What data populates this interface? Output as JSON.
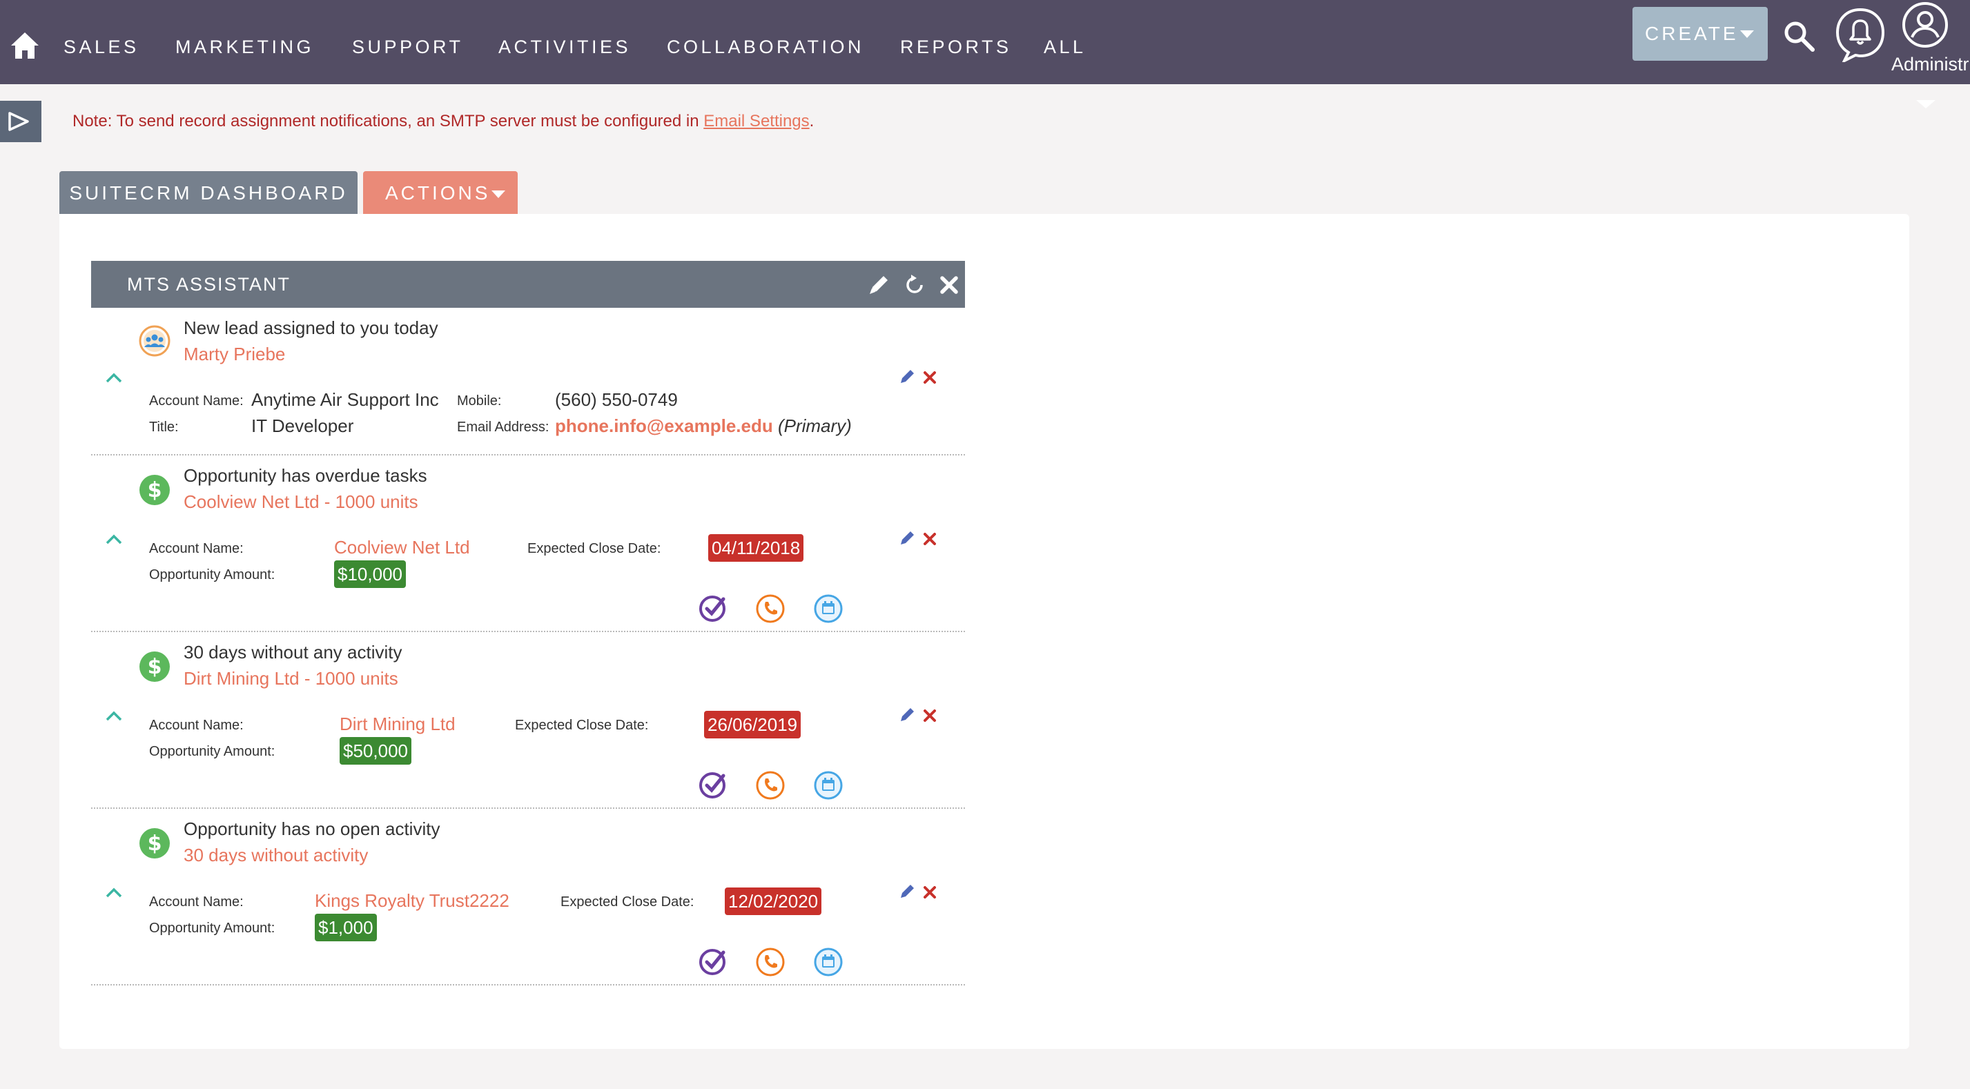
{
  "nav": {
    "items": [
      "SALES",
      "MARKETING",
      "SUPPORT",
      "ACTIVITIES",
      "COLLABORATION",
      "REPORTS",
      "ALL"
    ],
    "create_label": "CREATE",
    "user_label": "Administr"
  },
  "note": {
    "text": "Note: To send record assignment notifications, an SMTP server must be configured in ",
    "link": "Email Settings",
    "suffix": "."
  },
  "tabs": {
    "dashboard": "SUITECRM DASHBOARD",
    "actions": "ACTIONS"
  },
  "dashlet": {
    "title": "MTS ASSISTANT",
    "items": [
      {
        "title": "New lead assigned to you today",
        "link": "Marty Priebe",
        "account_label": "Account Name:",
        "account_value": "Anytime Air Support Inc",
        "title_label": "Title:",
        "title_value": "IT Developer",
        "mobile_label": "Mobile:",
        "mobile_value": "(560) 550-0749",
        "email_label": "Email Address:",
        "email_value": "phone.info@example.edu",
        "email_note": "(Primary)"
      },
      {
        "title": "Opportunity has overdue tasks",
        "link": "Coolview Net Ltd - 1000 units",
        "account_label": "Account Name:",
        "account_value": "Coolview Net Ltd",
        "amount_label": "Opportunity Amount:",
        "amount_value": "$10,000",
        "close_label": "Expected Close Date:",
        "close_value": "04/11/2018"
      },
      {
        "title": "30 days without any activity",
        "link": "Dirt Mining Ltd - 1000 units",
        "account_label": "Account Name:",
        "account_value": "Dirt Mining Ltd",
        "amount_label": "Opportunity Amount:",
        "amount_value": "$50,000",
        "close_label": "Expected Close Date:",
        "close_value": "26/06/2019"
      },
      {
        "title": "Opportunity has no open activity",
        "link": "30 days without activity",
        "account_label": "Account Name:",
        "account_value": "Kings Royalty Trust2222",
        "amount_label": "Opportunity Amount:",
        "amount_value": "$1,000",
        "close_label": "Expected Close Date:",
        "close_value": "12/02/2020"
      }
    ]
  },
  "icons": {
    "home": "home-icon",
    "search": "search-icon",
    "notifications": "bell-icon",
    "user": "user-icon",
    "lead": "lead-icon",
    "opportunity": "dollar-icon",
    "task": "task-icon",
    "call": "phone-icon",
    "meeting": "calendar-icon"
  },
  "colors": {
    "nav_bg": "#534d64",
    "accent": "#e7755d",
    "overdue": "#c8312b",
    "amount": "#3c8a32",
    "dashlet_header": "#6b7480"
  }
}
